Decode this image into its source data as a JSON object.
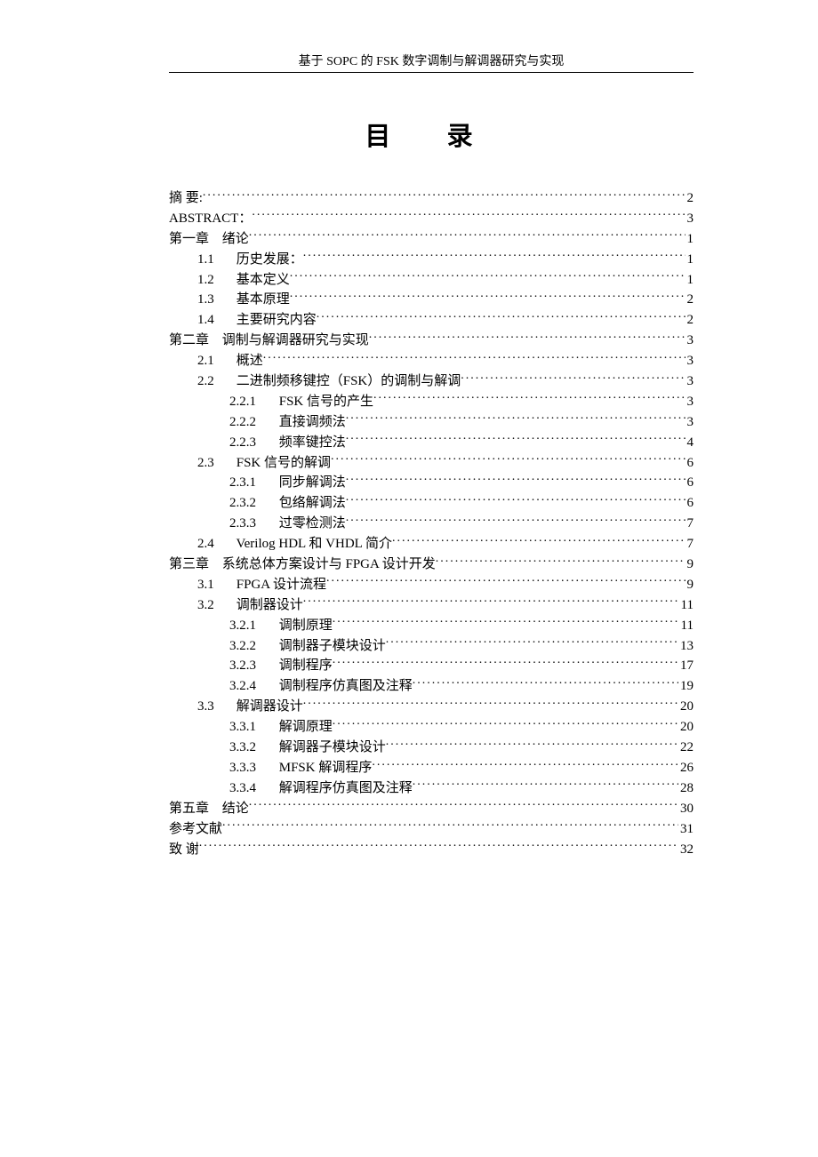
{
  "header": "基于 SOPC 的 FSK 数字调制与解调器研究与实现",
  "title": "目  录",
  "toc": [
    {
      "level": 0,
      "num": "",
      "label": "摘  要:",
      "page": "2"
    },
    {
      "level": 0,
      "num": "",
      "label": "ABSTRACT：",
      "page": "3"
    },
    {
      "level": 0,
      "num": "第一章",
      "label": "绪论",
      "page": "1"
    },
    {
      "level": 1,
      "num": "1.1",
      "label": "历史发展：",
      "page": "1"
    },
    {
      "level": 1,
      "num": "1.2",
      "label": "基本定义",
      "page": "1"
    },
    {
      "level": 1,
      "num": "1.3",
      "label": "基本原理",
      "page": "2"
    },
    {
      "level": 1,
      "num": "1.4",
      "label": "主要研究内容",
      "page": "2"
    },
    {
      "level": 0,
      "num": "第二章",
      "label": "调制与解调器研究与实现",
      "page": "3"
    },
    {
      "level": 1,
      "num": "2.1",
      "label": "概述",
      "page": "3"
    },
    {
      "level": 1,
      "num": "2.2",
      "label": "二进制频移键控（FSK）的调制与解调",
      "page": "3"
    },
    {
      "level": 2,
      "num": "2.2.1",
      "label": "FSK 信号的产生",
      "page": "3"
    },
    {
      "level": 2,
      "num": "2.2.2",
      "label": "直接调频法",
      "page": "3"
    },
    {
      "level": 2,
      "num": "2.2.3",
      "label": "频率键控法",
      "page": "4"
    },
    {
      "level": 1,
      "num": "2.3",
      "label": "FSK 信号的解调",
      "page": "6"
    },
    {
      "level": 2,
      "num": "2.3.1",
      "label": "同步解调法",
      "page": "6"
    },
    {
      "level": 2,
      "num": "2.3.2",
      "label": "包络解调法",
      "page": "6"
    },
    {
      "level": 2,
      "num": "2.3.3",
      "label": "过零检测法",
      "page": "7"
    },
    {
      "level": 1,
      "num": "2.4",
      "label": "Verilog   HDL 和 VHDL 简介",
      "page": "7"
    },
    {
      "level": 0,
      "num": "第三章",
      "label": "系统总体方案设计与  FPGA  设计开发",
      "page": "9"
    },
    {
      "level": 1,
      "num": "3.1",
      "label": "FPGA  设计流程",
      "page": "9"
    },
    {
      "level": 1,
      "num": "3.2",
      "label": "调制器设计",
      "page": "11"
    },
    {
      "level": 2,
      "num": "3.2.1",
      "label": "调制原理",
      "page": "11"
    },
    {
      "level": 2,
      "num": "3.2.2",
      "label": "调制器子模块设计",
      "page": "13"
    },
    {
      "level": 2,
      "num": "3.2.3",
      "label": "调制程序",
      "page": "17"
    },
    {
      "level": 2,
      "num": "3.2.4",
      "label": "调制程序仿真图及注释",
      "page": "19"
    },
    {
      "level": 1,
      "num": "3.3",
      "label": "解调器设计",
      "page": "20"
    },
    {
      "level": 2,
      "num": "3.3.1",
      "label": "解调原理",
      "page": "20"
    },
    {
      "level": 2,
      "num": "3.3.2",
      "label": "解调器子模块设计",
      "page": "22"
    },
    {
      "level": 2,
      "num": "3.3.3",
      "label": "MFSK 解调程序",
      "page": "26"
    },
    {
      "level": 2,
      "num": "3.3.4",
      "label": "解调程序仿真图及注释",
      "page": "28"
    },
    {
      "level": 0,
      "num": "第五章",
      "label": "结论",
      "page": "30"
    },
    {
      "level": 0,
      "num": "",
      "label": "参考文献",
      "page": "31"
    },
    {
      "level": 0,
      "num": "",
      "label": "致    谢",
      "page": "32"
    }
  ]
}
